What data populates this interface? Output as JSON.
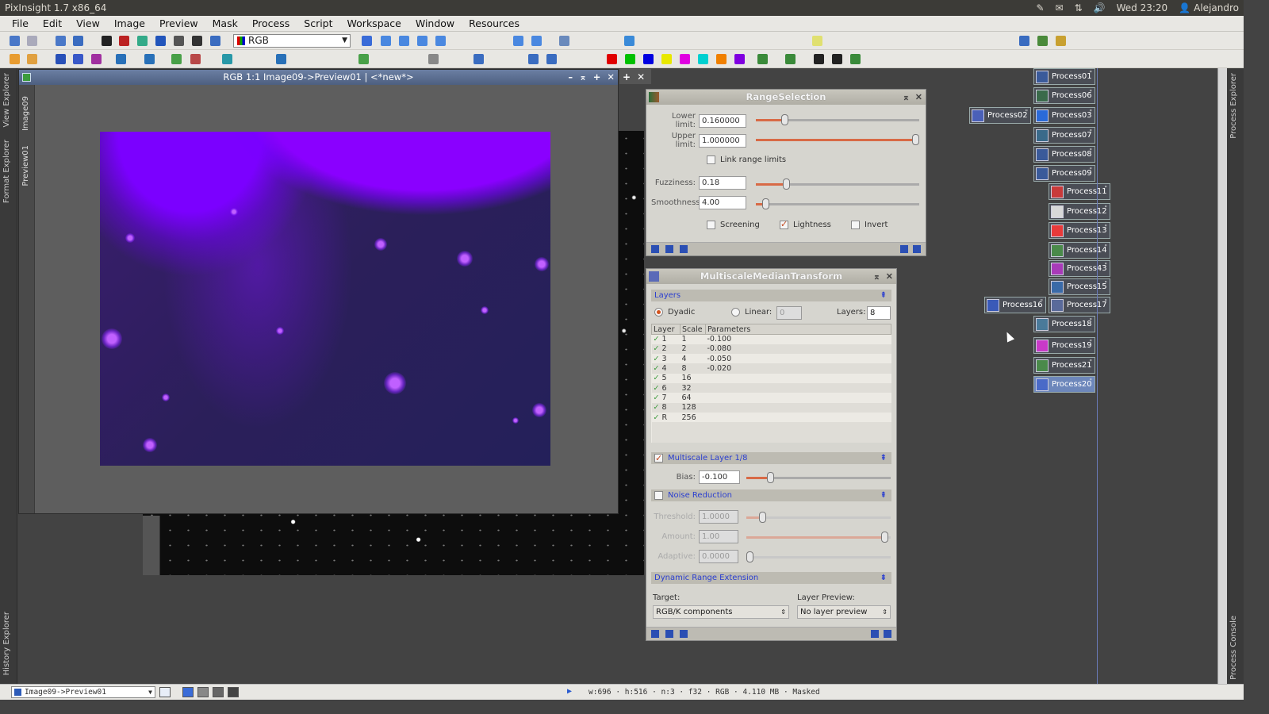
{
  "system": {
    "title": "PixInsight 1.7 x86_64",
    "clock": "Wed 23:20",
    "user": "Alejandro"
  },
  "menu": [
    "File",
    "Edit",
    "View",
    "Image",
    "Preview",
    "Mask",
    "Process",
    "Script",
    "Workspace",
    "Window",
    "Resources"
  ],
  "toolbar": {
    "color_space": "RGB"
  },
  "left_tabs": [
    "View Explorer",
    "Format Explorer",
    "History Explorer"
  ],
  "right_tabs": [
    "Process Explorer",
    "Process Console"
  ],
  "image_window": {
    "title": "RGB 1:1 Image09->Preview01 | <*new*>",
    "tabs": [
      "Image09",
      "Preview01"
    ]
  },
  "range_selection": {
    "title": "RangeSelection",
    "lower_label": "Lower limit:",
    "lower_value": "0.160000",
    "lower_frac": 0.16,
    "upper_label": "Upper limit:",
    "upper_value": "1.000000",
    "upper_frac": 1.0,
    "link_label": "Link range limits",
    "fuzziness_label": "Fuzziness:",
    "fuzziness_value": "0.18",
    "smoothness_label": "Smoothness:",
    "smoothness_value": "4.00",
    "screening_label": "Screening",
    "lightness_label": "Lightness",
    "invert_label": "Invert"
  },
  "mmt": {
    "title": "MultiscaleMedianTransform",
    "layers_section": "Layers",
    "dyadic_label": "Dyadic",
    "linear_label": "Linear:",
    "linear_value": "0",
    "layers_label": "Layers:",
    "layers_value": "8",
    "columns": [
      "Layer",
      "Scale",
      "Parameters"
    ],
    "rows": [
      [
        "1",
        "1",
        "-0.100"
      ],
      [
        "2",
        "2",
        "-0.080"
      ],
      [
        "3",
        "4",
        "-0.050"
      ],
      [
        "4",
        "8",
        "-0.020"
      ],
      [
        "5",
        "16",
        ""
      ],
      [
        "6",
        "32",
        ""
      ],
      [
        "7",
        "64",
        ""
      ],
      [
        "8",
        "128",
        ""
      ],
      [
        "R",
        "256",
        ""
      ]
    ],
    "layer_section": "Multiscale Layer 1/8",
    "bias_label": "Bias:",
    "bias_value": "-0.100",
    "noise_section": "Noise Reduction",
    "threshold_label": "Threshold:",
    "threshold_value": "1.0000",
    "amount_label": "Amount:",
    "amount_value": "1.00",
    "adaptive_label": "Adaptive:",
    "adaptive_value": "0.0000",
    "dre_section": "Dynamic Range Extension",
    "target_label": "Target:",
    "target_value": "RGB/K components",
    "preview_label": "Layer Preview:",
    "preview_value": "No layer preview"
  },
  "process_icons": [
    "Process01",
    "Process06",
    "Process02",
    "Process03",
    "Process07",
    "Process08",
    "Process09",
    "Process11",
    "Process12",
    "Process13",
    "Process14",
    "Process43",
    "Process15",
    "Process16",
    "Process17",
    "Process18",
    "Process19",
    "Process21",
    "Process20"
  ],
  "status": {
    "view": "Image09->Preview01",
    "info": "w:696  ·  h:516  ·  n:3  ·  f32  ·  RGB  ·  4.110 MB  ·  Masked"
  }
}
